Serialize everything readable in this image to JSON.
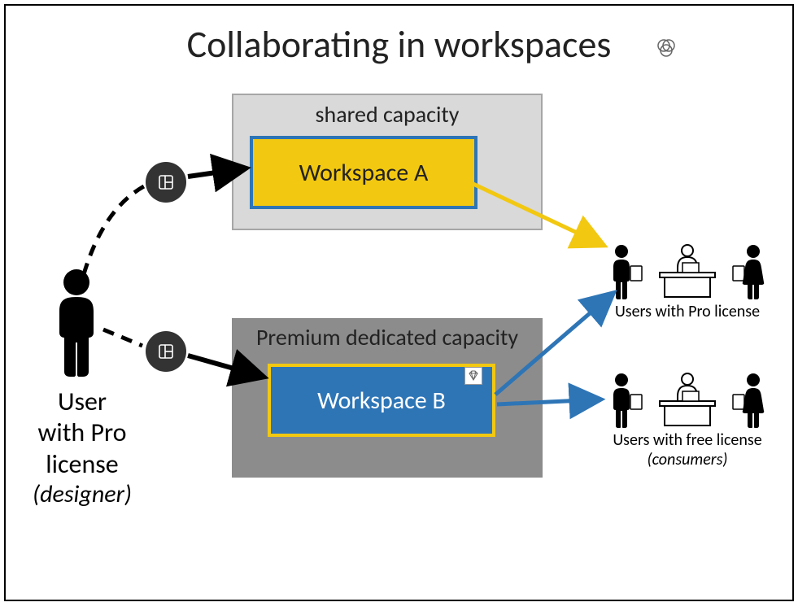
{
  "title": "Collaborating in workspaces",
  "user": {
    "label_line1": "User",
    "label_line2": "with Pro",
    "label_line3": "license",
    "label_role": "(designer)"
  },
  "shared_capacity": {
    "label": "shared capacity",
    "workspace_label": "Workspace A"
  },
  "premium_capacity": {
    "label": "Premium dedicated capacity",
    "workspace_label": "Workspace B"
  },
  "audience_pro": {
    "label": "Users with Pro license"
  },
  "audience_free": {
    "label": "Users with free license",
    "sublabel": "(consumers)"
  },
  "colors": {
    "yellow": "#f2c811",
    "blue": "#2e75b6",
    "dark_circle": "#333333",
    "grey_light": "#d9d9d9",
    "grey_dark": "#8c8c8c"
  }
}
